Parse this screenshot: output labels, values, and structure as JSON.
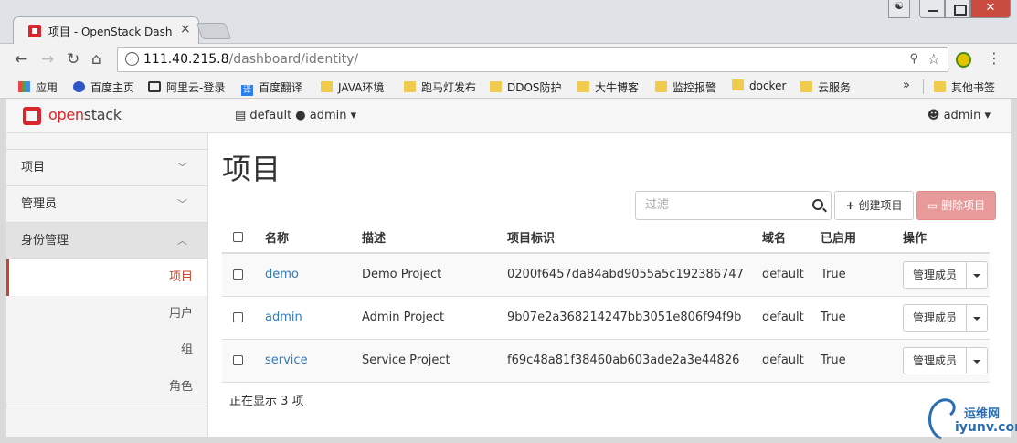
{
  "browser": {
    "tab_title": "项目 - OpenStack Dash",
    "tab_close": "×",
    "url_host": "111.40.215.8",
    "url_path": "/dashboard/identity/",
    "win_close": "✕",
    "bookmarks": [
      {
        "label": "应用",
        "icon": "apps-icon"
      },
      {
        "label": "百度主页",
        "icon": "baidu-icon"
      },
      {
        "label": "阿里云-登录",
        "icon": "aliyun-icon"
      },
      {
        "label": "百度翻译",
        "icon": "fanyi-icon"
      },
      {
        "label": "JAVA环境",
        "icon": "folder-icon"
      },
      {
        "label": "跑马灯发布",
        "icon": "folder-icon"
      },
      {
        "label": "DDOS防护",
        "icon": "folder-icon"
      },
      {
        "label": "大牛博客",
        "icon": "folder-icon"
      },
      {
        "label": "监控报警",
        "icon": "folder-icon"
      },
      {
        "label": "docker",
        "icon": "folder-icon"
      },
      {
        "label": "云服务",
        "icon": "folder-icon"
      }
    ],
    "bookmarks_more": "»",
    "other_bookmarks": "其他书签"
  },
  "header": {
    "logo_open": "open",
    "logo_stack": "stack",
    "context_domain": "default",
    "context_project": "admin",
    "user": "admin"
  },
  "sidebar": {
    "panels": [
      {
        "label": "项目",
        "chevron": "﹀"
      },
      {
        "label": "管理员",
        "chevron": "﹀"
      },
      {
        "label": "身份管理",
        "chevron": "︿"
      }
    ],
    "items": [
      {
        "label": "项目"
      },
      {
        "label": "用户"
      },
      {
        "label": "组"
      },
      {
        "label": "角色"
      }
    ]
  },
  "main": {
    "title": "项目",
    "filter_placeholder": "过滤",
    "create_label": "创建项目",
    "delete_label": "删除项目",
    "columns": [
      "名称",
      "描述",
      "项目标识",
      "域名",
      "已启用",
      "操作"
    ],
    "rows": [
      {
        "name": "demo",
        "description": "Demo Project",
        "id": "0200f6457da84abd9055a5c192386747",
        "domain": "default",
        "enabled": "True",
        "action": "管理成员"
      },
      {
        "name": "admin",
        "description": "Admin Project",
        "id": "9b07e2a368214247bb3051e806f94f9b",
        "domain": "default",
        "enabled": "True",
        "action": "管理成员"
      },
      {
        "name": "service",
        "description": "Service Project",
        "id": "f69c48a81f38460ab603ade2a3e44826",
        "domain": "default",
        "enabled": "True",
        "action": "管理成员"
      }
    ],
    "count_text": "正在显示 3 项"
  },
  "watermark": {
    "cn": "运维网",
    "en": "iyunv.com"
  }
}
